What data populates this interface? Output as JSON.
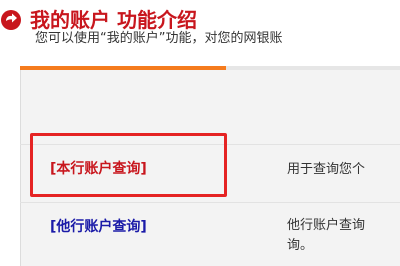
{
  "header": {
    "icon": "red-circle-arrow-icon",
    "title": "我的账户 功能介绍"
  },
  "colors": {
    "title": "#c8161d",
    "tab_active": "#f57b1d",
    "link_red": "#c8161d",
    "link_blue": "#1a1aa8",
    "highlight": "#e52323"
  },
  "intro": {
    "text": "您可以使用“我的账户”功能，对您的网银账"
  },
  "rows": [
    {
      "link": "[本行账户查询]",
      "description": "用于查询您个"
    },
    {
      "link": "[他行账户查询]",
      "description_line1": "他行账户查询",
      "description_line2": "询。"
    }
  ]
}
